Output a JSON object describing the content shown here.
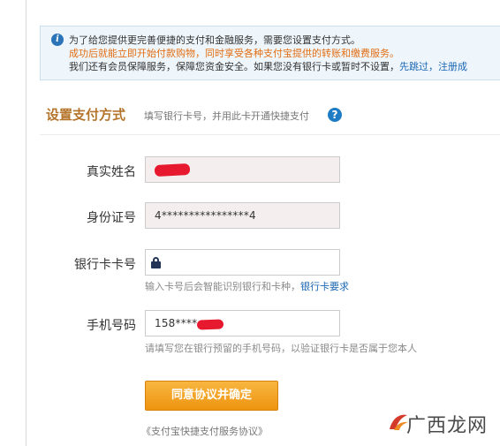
{
  "notice": {
    "line1": "为了给您提供更完善便捷的支付和金融服务，需要您设置支付方式。",
    "line2": "成功后就能立即开始付款购物，同时享受各种支付宝提供的转账和缴费服务。",
    "line3_text": "我们还有会员保障服务，保障您资金安全。如果您没有银行卡或暂时不设置，",
    "skip_link": "先跳过",
    "register_link": "，注册成"
  },
  "section": {
    "title": "设置支付方式",
    "subtitle": "填写银行卡号，并用此卡开通快捷支付",
    "help_glyph": "?"
  },
  "form": {
    "name_label": "真实姓名",
    "id_label": "身份证号",
    "id_value": "4****************4",
    "card_label": "银行卡卡号",
    "card_hint": "输入卡号后会智能识别银行和卡种，",
    "card_req_link": "银行卡要求",
    "phone_label": "手机号码",
    "phone_value": "158****",
    "phone_hint": "请填写您在银行预留的手机号码，以验证银行卡是否属于您本人"
  },
  "actions": {
    "submit_label": "同意协议并确定",
    "agreement_text": "《支付宝快捷支付服务协议》"
  },
  "watermark": {
    "text": "广西龙网"
  },
  "colors": {
    "accent": "#b4742b",
    "link": "#1a66b3",
    "button": "#f0a02a",
    "warning": "#e26d12",
    "redaction": "#e6192e"
  },
  "icons": {
    "info": "info-icon",
    "help": "help-icon",
    "lock": "lock-icon",
    "watermark": "dragon-logo-icon"
  }
}
